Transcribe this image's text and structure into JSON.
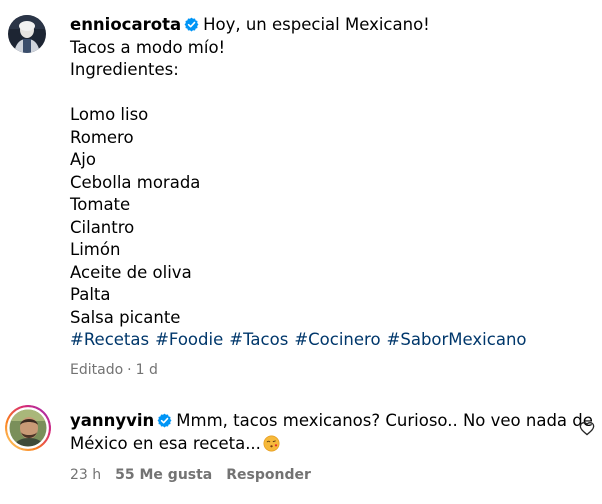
{
  "post": {
    "username": "enniocarota",
    "caption_first_line": "Hoy, un especial Mexicano!",
    "caption_lines": [
      "Tacos a modo mío!",
      "Ingredientes:",
      "",
      "Lomo liso",
      "Romero",
      "Ajo",
      "Cebolla morada",
      "Tomate",
      "Cilantro",
      "Limón",
      "Aceite de oliva",
      "Palta",
      "Salsa picante"
    ],
    "hashtags": [
      "#Recetas",
      "#Foodie",
      "#Tacos",
      "#Cocinero",
      "#SaborMexicano"
    ],
    "edited_label": "Editado",
    "time": "1 d"
  },
  "reply": {
    "username": "yannyvin",
    "text_line1": "Mmm, tacos mexicanos? Curioso.. No veo nada de",
    "text_line2": "México en esa receta...",
    "time": "23 h",
    "likes": "55 Me gusta",
    "reply_label": "Responder"
  },
  "colors": {
    "verified_badge": "#0095f6",
    "hashtag": "#00376b",
    "meta_text": "#737373",
    "story_ring": [
      "#feda75",
      "#fa7e1e",
      "#d62976",
      "#962fbf"
    ]
  },
  "icons": {
    "verified": "verified-badge-icon",
    "like": "heart-outline-icon",
    "emoji": "face-blowing-kiss-emoji"
  }
}
